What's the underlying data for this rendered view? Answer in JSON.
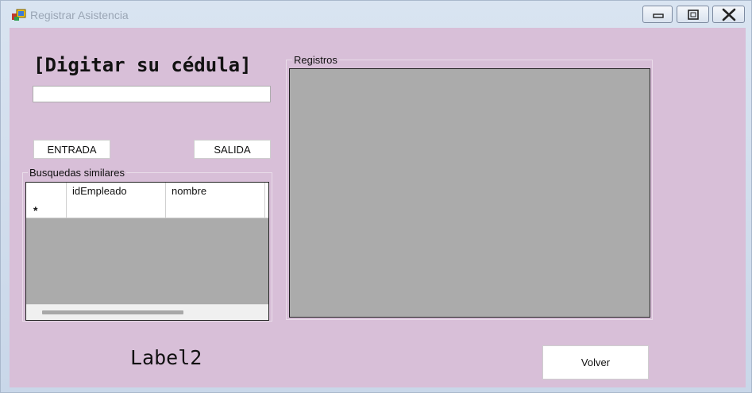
{
  "window": {
    "title": "Registrar Asistencia",
    "icon": "app-form-icon",
    "controls": [
      "minimize-icon",
      "maximize-icon",
      "close-icon"
    ]
  },
  "form": {
    "heading": "[Digitar su cédula]",
    "cedula_value": "",
    "entrada_label": "ENTRADA",
    "salida_label": "SALIDA",
    "label2": "Label2",
    "volver_label": "Volver"
  },
  "search_group": {
    "label": "Busquedas similares",
    "columns": [
      "idEmpleado",
      "nombre"
    ],
    "new_row_marker": "*"
  },
  "records_group": {
    "label": "Registros"
  },
  "colors": {
    "form_background": "#d8bfd8",
    "grid_background": "#ababab"
  }
}
